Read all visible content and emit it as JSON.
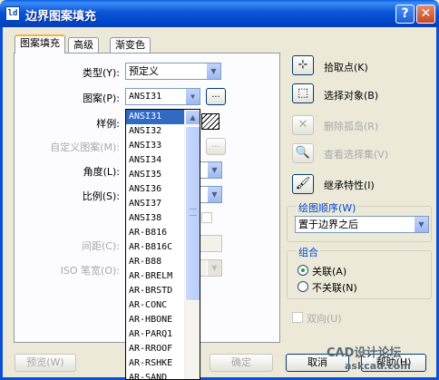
{
  "window": {
    "title": "边界图案填充",
    "icon": "autocad-icon",
    "help_label": "?",
    "close_label": "✕"
  },
  "tabs": [
    {
      "label": "图案填充",
      "active": true
    },
    {
      "label": "高级",
      "active": false
    },
    {
      "label": "渐变色",
      "active": false
    }
  ],
  "form": {
    "type_label": "类型(Y):",
    "type_value": "预定义",
    "pattern_label": "图案(P):",
    "pattern_value": "ANSI31",
    "pattern_browse": "...",
    "sample_label": "样例:",
    "custom_label": "自定义图案(M):",
    "custom_browse": "...",
    "angle_label": "角度(L):",
    "scale_label": "比例(S):",
    "spacing_label": "间距(C):",
    "iso_label": "ISO 笔宽(O):"
  },
  "pattern_list": {
    "selected": "ANSI31",
    "items": [
      "ANSI31",
      "ANSI32",
      "ANSI33",
      "ANSI34",
      "ANSI35",
      "ANSI36",
      "ANSI37",
      "ANSI38",
      "AR-B816",
      "AR-B816C",
      "AR-B88",
      "AR-BRELM",
      "AR-BRSTD",
      "AR-CONC",
      "AR-HBONE",
      "AR-PARQ1",
      "AR-RROOF",
      "AR-RSHKE",
      "AR-SAND"
    ]
  },
  "side_actions": [
    {
      "label": "拾取点(K)",
      "icon": "pick-point-icon",
      "glyph": "⊹",
      "enabled": true
    },
    {
      "label": "选择对象(B)",
      "icon": "select-objects-icon",
      "glyph": "⬚",
      "enabled": true
    },
    {
      "label": "删除孤岛(R)",
      "icon": "remove-islands-icon",
      "glyph": "✕",
      "enabled": false
    },
    {
      "label": "查看选择集(V)",
      "icon": "view-selection-icon",
      "glyph": "🔍",
      "enabled": false
    },
    {
      "label": "继承特性(I)",
      "icon": "inherit-properties-icon",
      "glyph": "🖌",
      "enabled": true
    }
  ],
  "draw_order": {
    "title": "绘图顺序(W)",
    "value": "置于边界之后"
  },
  "composition": {
    "title": "组合",
    "associative": "关联(A)",
    "nonassociative": "不关联(N)",
    "selected": "associative"
  },
  "double_label": "双向(U)",
  "buttons": {
    "preview": "预览(W)",
    "ok": "确定",
    "cancel": "取消",
    "help": "帮助(H)"
  },
  "watermark": {
    "line1": "CAD设计论坛",
    "line2": "askcad.com"
  },
  "colors": {
    "titlebar": "#0a55d6",
    "selection": "#316ac5",
    "group_title": "#0046d5"
  }
}
